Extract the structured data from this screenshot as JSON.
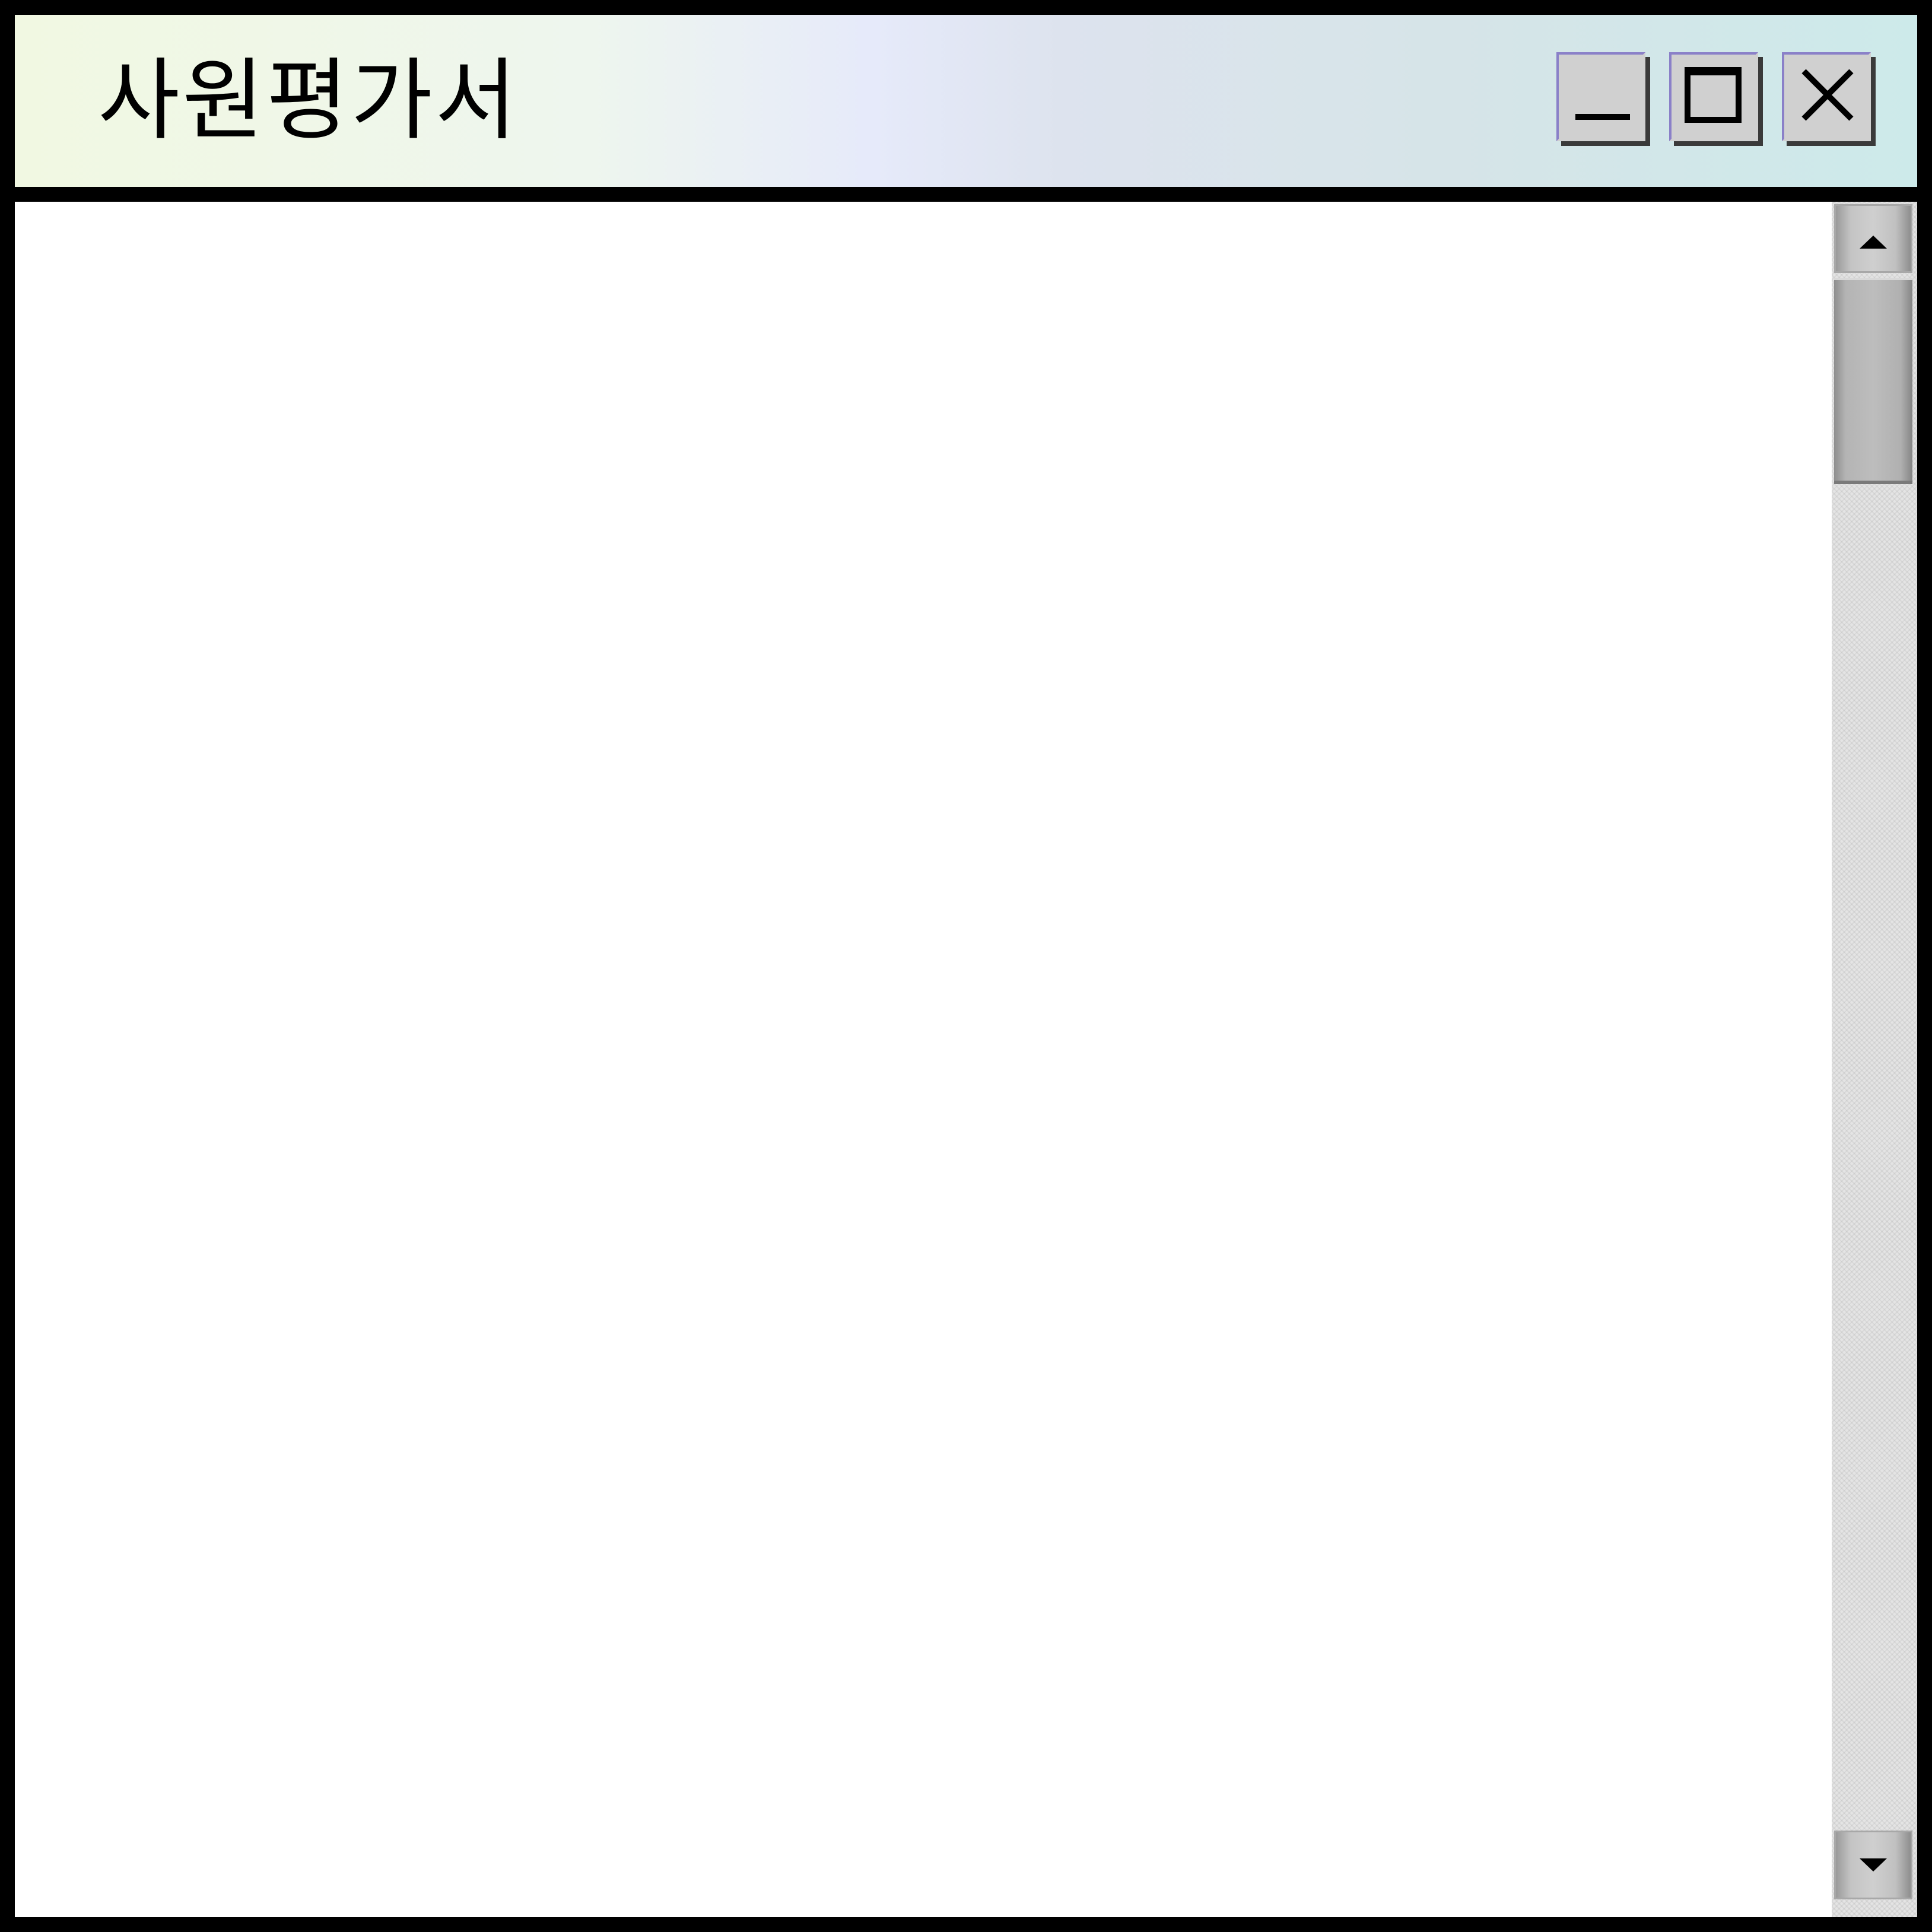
{
  "window": {
    "title": "사원평가서",
    "controls": {
      "minimize": "minimize-icon",
      "maximize": "maximize-icon",
      "close": "close-icon"
    }
  },
  "scrollbar": {
    "up_icon": "arrow-up-icon",
    "down_icon": "arrow-down-icon",
    "position": 0
  },
  "colors": {
    "frame": "#000000",
    "content_bg": "#ffffff",
    "button_face": "#d0d0d0"
  }
}
